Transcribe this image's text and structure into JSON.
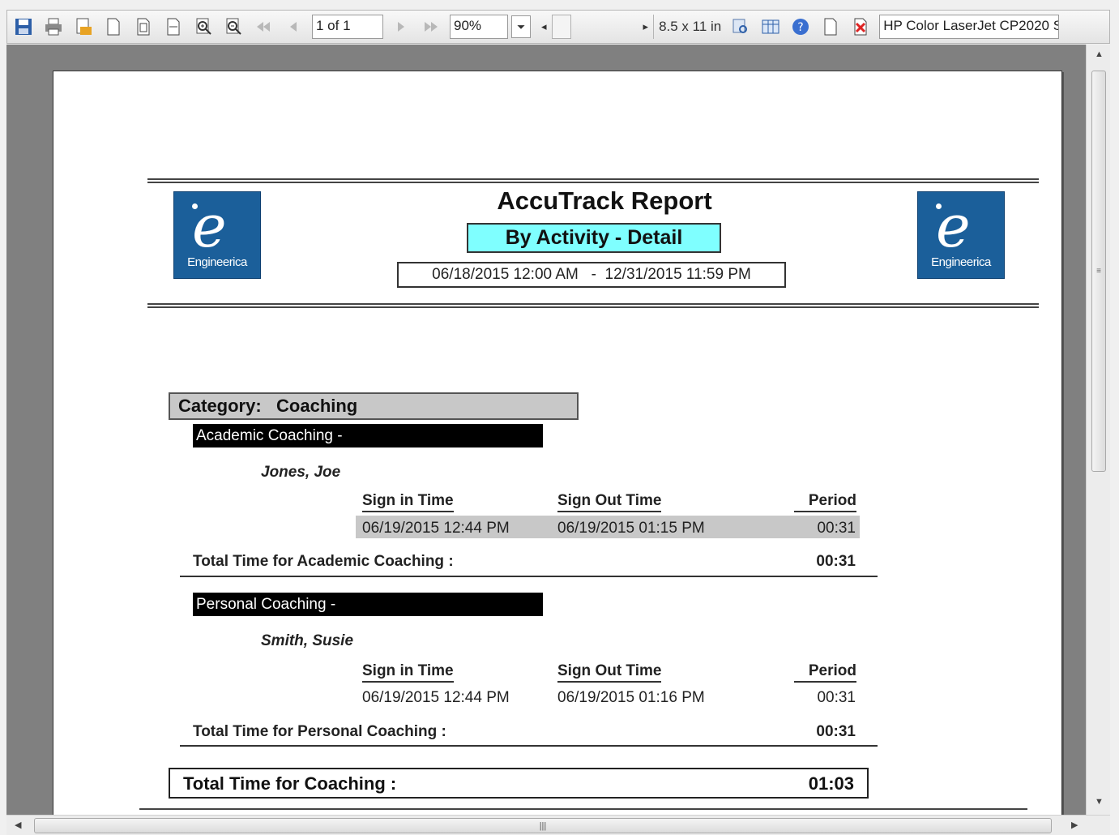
{
  "toolbar": {
    "page_indicator": "1 of 1",
    "zoom": "90%",
    "paper_size": "8.5 x 11 in",
    "printer": "HP Color LaserJet CP2020 S"
  },
  "report": {
    "title": "AccuTrack Report",
    "subtitle": "By Activity - Detail",
    "date_range": "06/18/2015 12:00 AM   -  12/31/2015 11:59 PM",
    "logo_text": "Engineerica",
    "category_label": "Category:   Coaching",
    "columns": {
      "sign_in": "Sign in Time",
      "sign_out": "Sign Out Time",
      "period": "Period"
    },
    "activities": [
      {
        "header": "Academic Coaching -",
        "person": "Jones, Joe",
        "sign_in": "06/19/2015 12:44 PM",
        "sign_out": "06/19/2015 01:15 PM",
        "period": "00:31",
        "total_label": "Total Time for Academic Coaching :",
        "total_value": "00:31"
      },
      {
        "header": "Personal Coaching -",
        "person": "Smith, Susie",
        "sign_in": "06/19/2015 12:44 PM",
        "sign_out": "06/19/2015 01:16 PM",
        "period": "00:31",
        "total_label": "Total Time for Personal Coaching :",
        "total_value": "00:31"
      }
    ],
    "grand_total_label": "Total Time for Coaching :",
    "grand_total_value": "01:03"
  }
}
